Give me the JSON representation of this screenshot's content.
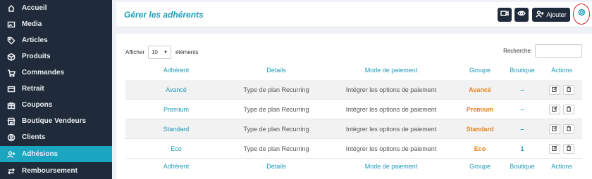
{
  "sidebar": {
    "items": [
      {
        "label": "Accueil",
        "icon": "home-icon"
      },
      {
        "label": "Media",
        "icon": "media-icon"
      },
      {
        "label": "Articles",
        "icon": "tag-icon"
      },
      {
        "label": "Produits",
        "icon": "box-icon"
      },
      {
        "label": "Commandes",
        "icon": "cart-icon"
      },
      {
        "label": "Retrait",
        "icon": "card-icon"
      },
      {
        "label": "Coupons",
        "icon": "gift-icon"
      },
      {
        "label": "Boutique Vendeurs",
        "icon": "store-icon"
      },
      {
        "label": "Clients",
        "icon": "client-icon"
      },
      {
        "label": "Adhésions",
        "icon": "user-add-icon",
        "active": true
      },
      {
        "label": "Remboursement",
        "icon": "refund-icon"
      }
    ],
    "active_color": "#1aa5c0"
  },
  "header": {
    "title": "Gérer les adhérents",
    "add_label": "Ajouter"
  },
  "table": {
    "show_prefix": "Afficher",
    "page_size": "10",
    "show_suffix": "éléments",
    "search_label": "Recherche:",
    "columns": [
      "Adhérent",
      "Détails",
      "Mode de paiement",
      "Groupe",
      "Boutique",
      "Actions"
    ],
    "rows": [
      {
        "name": "Avancé",
        "details": "Type de plan Recurring",
        "payment": "Intégrer les options de paiement",
        "group": "Avancé",
        "shop": "–"
      },
      {
        "name": "Premium",
        "details": "Type de plan Recurring",
        "payment": "Intégrer les options de paiement",
        "group": "Premium",
        "shop": "–"
      },
      {
        "name": "Standard",
        "details": "Type de plan Recurring",
        "payment": "Intégrer les options de paiement",
        "group": "Standard",
        "shop": "–"
      },
      {
        "name": "Eco",
        "details": "Type de plan Recurring",
        "payment": "Intégrer les options de paiement",
        "group": "Eco",
        "shop": "1"
      }
    ]
  },
  "colors": {
    "accent": "#1f9bb7",
    "group": "#e8821c",
    "sidebar_bg": "#1f2b3a",
    "highlight_ring": "#d9262b"
  }
}
